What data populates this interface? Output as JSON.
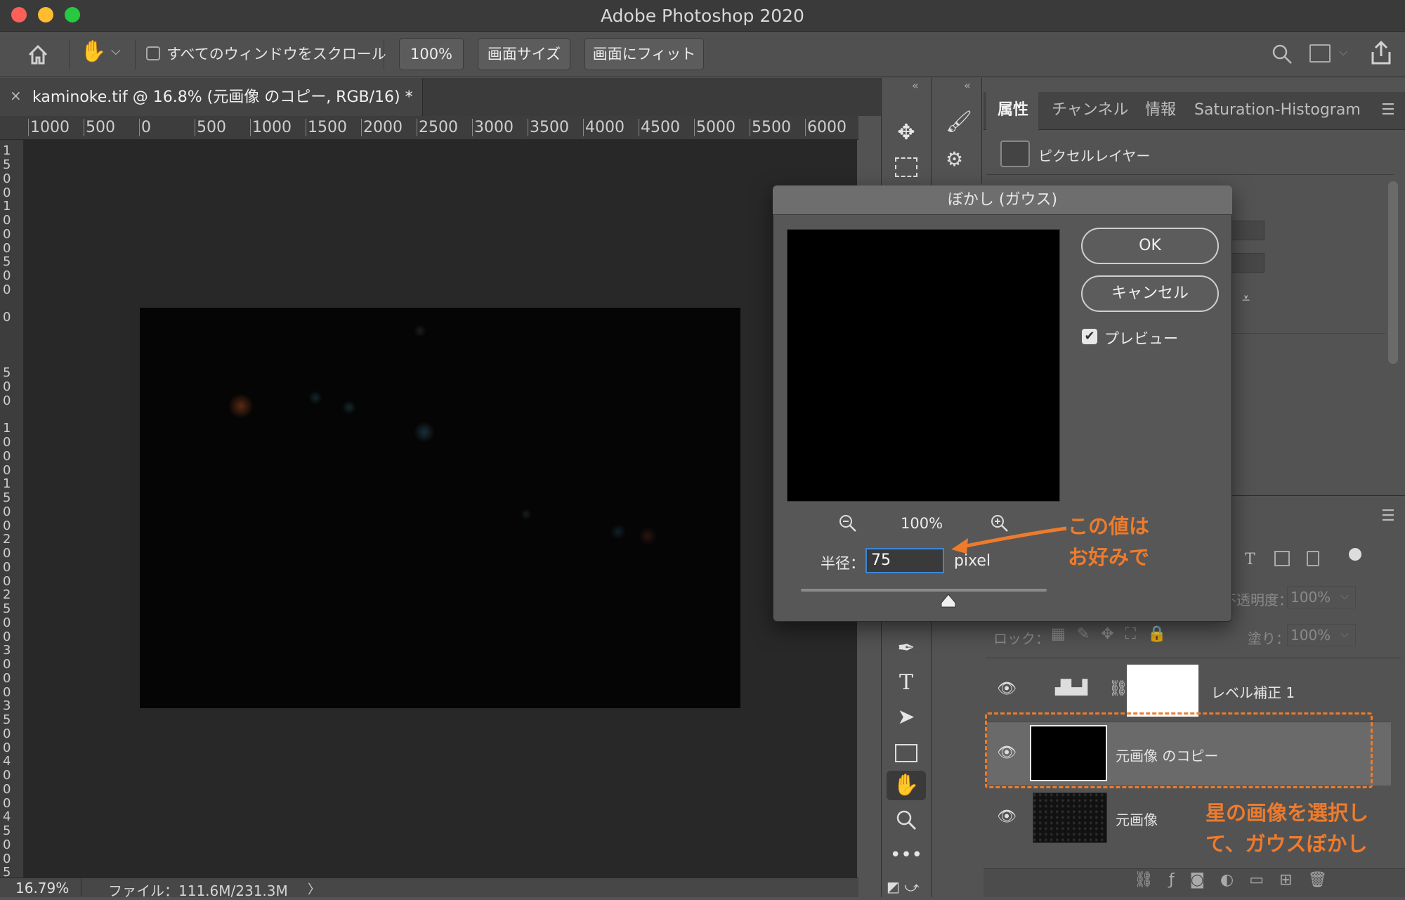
{
  "window": {
    "title": "Adobe Photoshop 2020"
  },
  "options_bar": {
    "scroll_all_label": "すべてのウィンドウをスクロール",
    "zoom_100_label": "100%",
    "screen_size_label": "画面サイズ",
    "fit_screen_label": "画面にフィット"
  },
  "document": {
    "tab_close": "×",
    "tab_title": "kaminoke.tif @ 16.8% (元画像 のコピー, RGB/16) *"
  },
  "ruler": {
    "horizontal_ticks": [
      "1000",
      "500",
      "0",
      "500",
      "1000",
      "1500",
      "2000",
      "2500",
      "3000",
      "3500",
      "4000",
      "4500",
      "5000",
      "5500",
      "6000"
    ],
    "vertical_ticks": [
      "1500",
      "1000",
      "500",
      "0",
      "500",
      "1000",
      "1500",
      "2000",
      "2500",
      "3000",
      "3500",
      "4000",
      "4500",
      "5"
    ]
  },
  "status_bar": {
    "zoom": "16.79%",
    "file_info": "ファイル：111.6M/231.3M",
    "arrow": "〉"
  },
  "properties_panel": {
    "tabs": [
      "属性",
      "チャンネル",
      "情報",
      "Saturation-Histogram"
    ],
    "active_tab": "属性",
    "layer_kind": "ピクセルレイヤー"
  },
  "layers_panel": {
    "opacity_label": "不透明度：",
    "opacity_value": "100%",
    "lock_label": "ロック：",
    "fill_label": "塗り：",
    "fill_value": "100%",
    "layers": [
      {
        "name": "レベル補正 1",
        "visible": true
      },
      {
        "name": "元画像 のコピー",
        "visible": true,
        "selected": true
      },
      {
        "name": "元画像",
        "visible": true
      }
    ]
  },
  "dialog": {
    "title": "ぼかし (ガウス)",
    "ok_label": "OK",
    "cancel_label": "キャンセル",
    "preview_label": "プレビュー",
    "preview_checked": true,
    "zoom_value": "100%",
    "radius_label": "半径：",
    "radius_value": "75",
    "unit_label": "pixel",
    "slider_position": 0.6
  },
  "annotations": {
    "radius_note_line1": "この値は",
    "radius_note_line2": "お好みで",
    "layer_note_line1": "星の画像を選択し",
    "layer_note_line2": "て、ガウスぼかし"
  },
  "colors": {
    "annotation": "#ee7b2c",
    "input_focus": "#3d86d9"
  }
}
